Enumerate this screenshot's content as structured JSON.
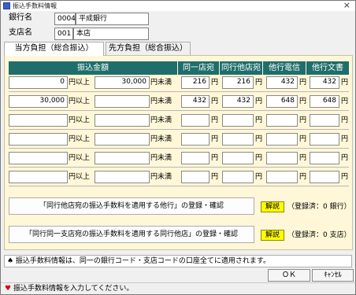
{
  "window": {
    "title": "振込手数料情報",
    "close_glyph": "×"
  },
  "bank": {
    "label": "銀行名",
    "code": "0004",
    "name": "平成銀行"
  },
  "branch": {
    "label": "支店名",
    "code": "001",
    "name": "本店"
  },
  "tabs": [
    {
      "label": "当方負担（総合振込）"
    },
    {
      "label": "先方負担（総合振込）"
    }
  ],
  "table": {
    "headers": [
      "振込金額",
      "同一店宛",
      "同行他店宛",
      "他行電信",
      "他行文書"
    ],
    "unit_from": "円以上",
    "unit_to": "円未満",
    "unit_yen": "円",
    "rows": [
      {
        "from": "0",
        "to": "30,000",
        "fees": [
          "216",
          "216",
          "432",
          "432"
        ]
      },
      {
        "from": "30,000",
        "to": "",
        "fees": [
          "432",
          "432",
          "648",
          "648"
        ]
      },
      {
        "from": "",
        "to": "",
        "fees": [
          "",
          "",
          "",
          ""
        ]
      },
      {
        "from": "",
        "to": "",
        "fees": [
          "",
          "",
          "",
          ""
        ]
      },
      {
        "from": "",
        "to": "",
        "fees": [
          "",
          "",
          "",
          ""
        ]
      },
      {
        "from": "",
        "to": "",
        "fees": [
          "",
          "",
          "",
          ""
        ]
      }
    ]
  },
  "actions": [
    {
      "label": "「同行他店宛の振込手数料を適用する他行」の登録・確認",
      "help": "解説",
      "status": "（登録済：0 銀行）"
    },
    {
      "label": "「同行同一支店宛の振込手数料を適用する同行他店」の登録・確認",
      "help": "解説",
      "status": "（登録済：0 支店）"
    }
  ],
  "note": "♠ 振込手数料情報は、同一の銀行コード・支店コードの口座全てに適用されます。",
  "buttons": {
    "ok": "ＯＫ",
    "cancel": "ｷｬﾝｾﾙ"
  },
  "status_bar": {
    "text": "振込手数料情報を入力してください。"
  }
}
